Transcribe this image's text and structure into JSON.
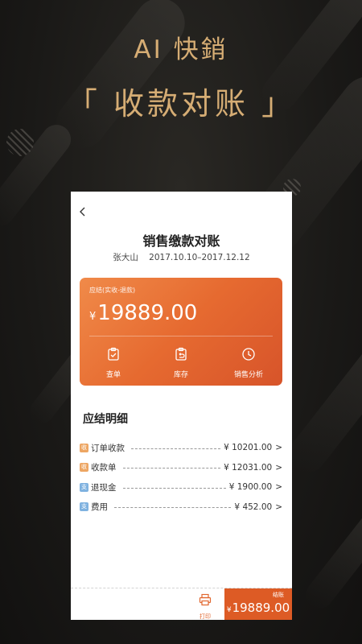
{
  "promo": {
    "headline": "AI 快銷",
    "tagline": "「 收款对账 」"
  },
  "screen": {
    "title": "销售缴款对账",
    "customer": "张大山",
    "date_range": "2017.10.10–2017.12.12"
  },
  "card": {
    "label": "应结(实收-退款)",
    "currency": "¥",
    "amount": "19889.00",
    "actions": [
      {
        "label": "查单",
        "icon": "clipboard-check-icon"
      },
      {
        "label": "库存",
        "icon": "inventory-return-icon"
      },
      {
        "label": "销售分析",
        "icon": "clock-icon"
      }
    ]
  },
  "details": {
    "title": "应结明细",
    "rows": [
      {
        "badge": "收",
        "badge_color": "#eda663",
        "name": "订单收款",
        "amount": "¥ 10201.00"
      },
      {
        "badge": "收",
        "badge_color": "#eda663",
        "name": "收款单",
        "amount": "¥ 12031.00"
      },
      {
        "badge": "支",
        "badge_color": "#7fb2e0",
        "name": "退现金",
        "amount": "¥ 1900.00"
      },
      {
        "badge": "支",
        "badge_color": "#7fb2e0",
        "name": "费用",
        "amount": "¥ 452.00"
      }
    ],
    "chevron": ">"
  },
  "footer": {
    "print_label": "打印",
    "total_label": "结账",
    "total_currency": "¥",
    "total_amount": "19889.00"
  },
  "colors": {
    "accent": "#dd5b25",
    "gold": "#d6ad74",
    "background": "#1b1a18"
  }
}
